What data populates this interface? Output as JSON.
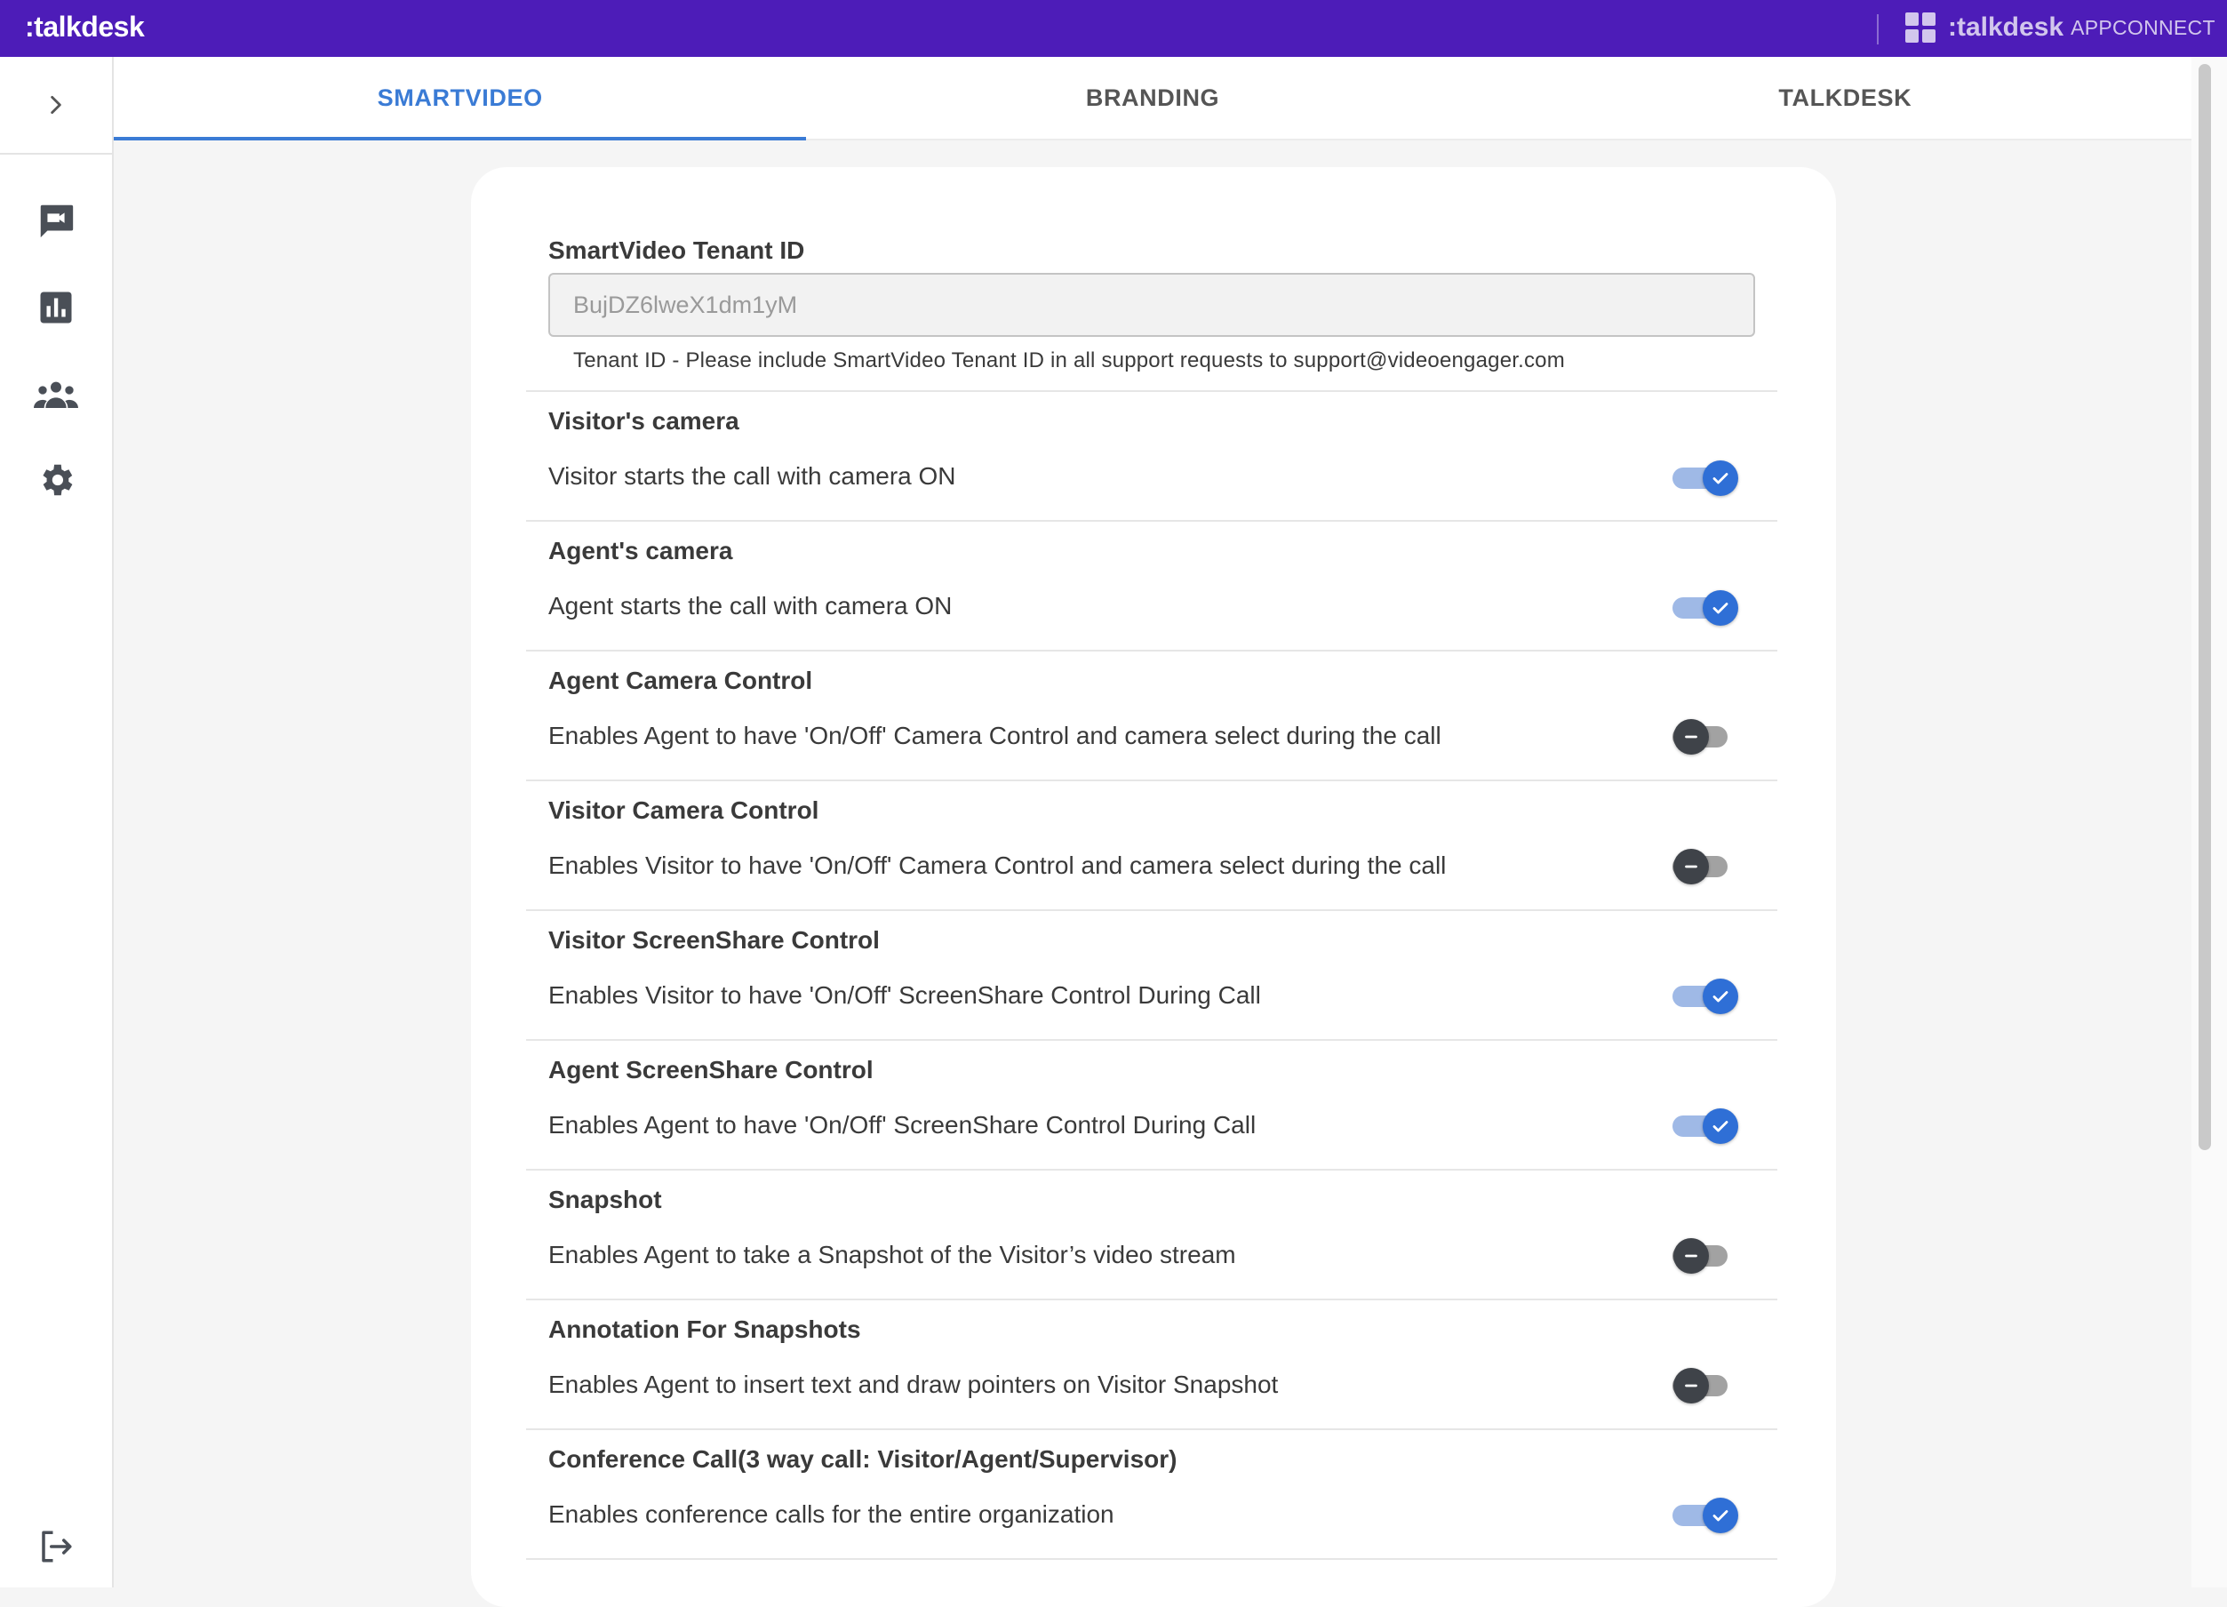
{
  "brand": {
    "logo_text": ":talkdesk",
    "appconnect_brand": ":talkdesk",
    "appconnect_suffix": "APPCONNECT"
  },
  "colors": {
    "topbar": "#4d1cb8",
    "accent": "#3a7bd5",
    "toggle_on": "#2f6fd6",
    "toggle_off": "#3f4349"
  },
  "sidebar": {
    "items": [
      {
        "icon": "video-chat-icon"
      },
      {
        "icon": "bar-chart-icon"
      },
      {
        "icon": "group-icon"
      },
      {
        "icon": "gear-icon"
      }
    ],
    "logout_icon": "logout-icon"
  },
  "tabs": [
    {
      "label": "SMARTVIDEO",
      "active": true
    },
    {
      "label": "BRANDING",
      "active": false
    },
    {
      "label": "TALKDESK",
      "active": false
    }
  ],
  "tenant": {
    "label": "SmartVideo Tenant ID",
    "value": "BujDZ6lweX1dm1yM",
    "help": "Tenant ID - Please include SmartVideo Tenant ID in all support requests to support@videoengager.com"
  },
  "settings": [
    {
      "title": "Visitor's camera",
      "description": "Visitor starts the call with camera ON",
      "enabled": true
    },
    {
      "title": "Agent's camera",
      "description": "Agent starts the call with camera ON",
      "enabled": true
    },
    {
      "title": "Agent Camera Control",
      "description": "Enables Agent to have 'On/Off' Camera Control and camera select during the call",
      "enabled": false
    },
    {
      "title": "Visitor Camera Control",
      "description": "Enables Visitor to have 'On/Off' Camera Control and camera select during the call",
      "enabled": false
    },
    {
      "title": "Visitor ScreenShare Control",
      "description": "Enables Visitor to have 'On/Off' ScreenShare Control During Call",
      "enabled": true
    },
    {
      "title": "Agent ScreenShare Control",
      "description": "Enables Agent to have 'On/Off' ScreenShare Control During Call",
      "enabled": true
    },
    {
      "title": "Snapshot",
      "description": "Enables Agent to take a Snapshot of the Visitor’s video stream",
      "enabled": false
    },
    {
      "title": "Annotation For Snapshots",
      "description": "Enables Agent to insert text and draw pointers on Visitor Snapshot",
      "enabled": false
    },
    {
      "title": "Conference Call(3 way call: Visitor/Agent/Supervisor)",
      "description": "Enables conference calls for the entire organization",
      "enabled": true
    }
  ]
}
